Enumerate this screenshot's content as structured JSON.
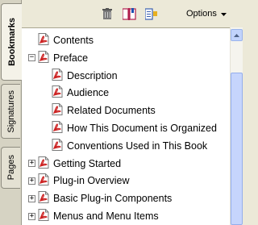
{
  "tabs": [
    {
      "label": "Bookmarks"
    },
    {
      "label": "Signatures"
    },
    {
      "label": "Pages"
    }
  ],
  "toolbar": {
    "options_label": "Options",
    "icons": [
      "trash-icon",
      "bookmark-new-icon",
      "bookmark-properties-icon",
      "dropdown-arrow-icon"
    ]
  },
  "bookmarks": [
    {
      "label": "Contents",
      "level": 0,
      "expander": "none"
    },
    {
      "label": "Preface",
      "level": 0,
      "expander": "minus"
    },
    {
      "label": "Description",
      "level": 1,
      "expander": "none"
    },
    {
      "label": "Audience",
      "level": 1,
      "expander": "none"
    },
    {
      "label": "Related Documents",
      "level": 1,
      "expander": "none"
    },
    {
      "label": "How This Document is Organized",
      "level": 1,
      "expander": "none"
    },
    {
      "label": "Conventions Used in This Book",
      "level": 1,
      "expander": "none"
    },
    {
      "label": "Getting Started",
      "level": 0,
      "expander": "plus"
    },
    {
      "label": "Plug-in Overview",
      "level": 0,
      "expander": "plus"
    },
    {
      "label": "Basic Plug-in Components",
      "level": 0,
      "expander": "plus"
    },
    {
      "label": "Menus and Menu Items",
      "level": 0,
      "expander": "plus"
    }
  ],
  "colors": {
    "tab_bar": "#d6d3c3",
    "panel_bg": "#ffffff",
    "scrollbar": "#c6d5fc",
    "bookmark_icon": "#cc2222"
  }
}
